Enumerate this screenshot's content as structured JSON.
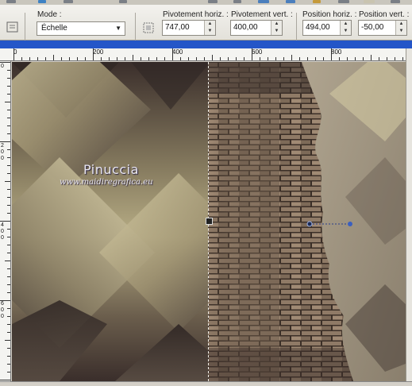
{
  "toolbar": {
    "mode_label": "Mode :",
    "mode_value": "Échelle",
    "pivot_h_label": "Pivotement horiz. :",
    "pivot_h_value": "747,00",
    "pivot_v_label": "Pivotement vert. :",
    "pivot_v_value": "400,00",
    "pos_h_label": "Position horiz. :",
    "pos_h_value": "494,00",
    "pos_v_label": "Position vert. :",
    "pos_v_value": "-50,00"
  },
  "ruler_h": [
    "0",
    "200",
    "400",
    "600",
    "800"
  ],
  "ruler_v": [
    "0",
    "2",
    "0",
    "0",
    "4",
    "0",
    "0",
    "6",
    "0",
    "0"
  ],
  "watermark": {
    "title": "Pinuccia",
    "url": "www.maidiregrafica.eu"
  },
  "colors": {
    "window_title": "#2456c8",
    "canvas_dark": "#3a2f2c",
    "canvas_cream": "#d8cfa6"
  }
}
